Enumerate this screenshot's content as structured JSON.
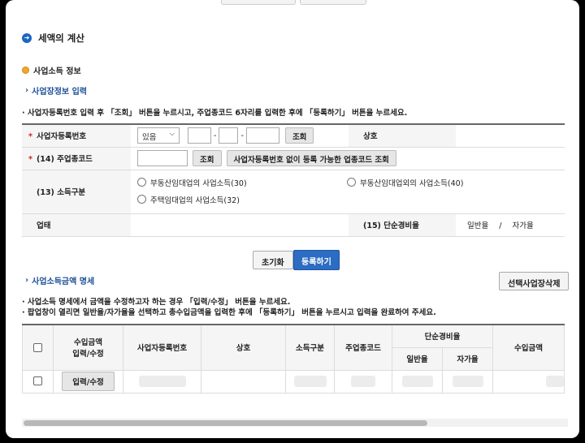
{
  "section": {
    "title": "세액의 계산",
    "icon": "circle-arrow-icon"
  },
  "income_info": {
    "title": "사업소득 정보",
    "workplace_link": "사업장정보 입력",
    "note": "· 사업자등록번호 입력 후 「조회」 버튼을 누르시고, 주업종코드 6자리를 입력한 후에 「등록하기」 버튼을 누르세요."
  },
  "form": {
    "biz_no_label": "사업자등록번호",
    "biz_no_select": "있음",
    "dash": "-",
    "lookup": "조회",
    "trade_name_label": "상호",
    "industry_code_label": "(14) 주업종코드",
    "industry_lookup_without": "사업자등록번호 없이 등록 가능한 업종코드 조회",
    "income_type_label": "(13) 소득구분",
    "income_options": [
      "부동산임대업의 사업소득(30)",
      "부동산임대업외의 사업소득(40)",
      "주택임대업의 사업소득(32)"
    ],
    "business_type_label": "업태",
    "expense_rate_label": "(15) 단순경비율",
    "general_rate": "일반율",
    "slash": "/",
    "own_rate": "자가율"
  },
  "actions": {
    "reset": "초기화",
    "register": "등록하기"
  },
  "income_detail": {
    "link": "사업소득금액 명세",
    "delete_button": "선택사업장삭제",
    "note1": "· 사업소득 명세에서 금액을 수정하고자 하는 경우 「입력/수정」 버튼을 누르세요.",
    "note2": "· 팝업창이 열리면 일반율/자가율을 선택하고 총수입금액을 입력한 후에 「등록하기」 버튼을 누르시고 입력을 완료하여 주세요."
  },
  "grid": {
    "col_income_amount": "수입금액",
    "col_input_edit": "입력/수정",
    "col_biz_no": "사업자등록번호",
    "col_trade_name": "상호",
    "col_income_type": "소득구분",
    "col_industry_code": "주업종코드",
    "col_simple_rate": "단순경비율",
    "col_general": "일반율",
    "col_own": "자가율",
    "col_revenue": "수입금액",
    "row_button": "입력/수정"
  }
}
